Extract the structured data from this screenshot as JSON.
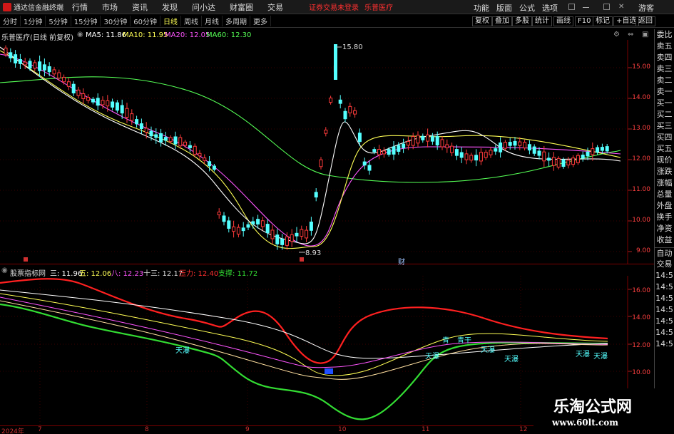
{
  "menubar": {
    "app_title": "通达信金融终端",
    "items": [
      "行情",
      "市场",
      "资讯",
      "发现",
      "问小达",
      "财富圈",
      "交易"
    ],
    "notice": "证券交易未登录",
    "stock_name": "乐普医疗",
    "right_items": [
      "功能",
      "版面",
      "公式",
      "选项"
    ],
    "guest": "游客"
  },
  "periodbar": {
    "periods": [
      "分时",
      "1分钟",
      "5分钟",
      "15分钟",
      "30分钟",
      "60分钟",
      "日线",
      "周线",
      "月线",
      "多周期",
      "更多"
    ],
    "active_period": "日线",
    "tools": [
      "复权",
      "叠加",
      "多股",
      "统计",
      "画线",
      "F10",
      "标记",
      "+自选",
      "返回"
    ]
  },
  "main_chart": {
    "stock_label": "乐普医疗(日线 前复权)",
    "ma5": "MA5: 11.86",
    "ma10": "MA10: 11.95",
    "ma20": "MA20: 12.05",
    "ma60": "MA60: 12.30",
    "high_label": "15.80",
    "low_label": "8.93",
    "marker_wealth": "财",
    "y_ticks": [
      "15.00",
      "14.00",
      "13.00",
      "12.00",
      "11.00",
      "10.00",
      "9.00"
    ]
  },
  "indicator": {
    "name": "股票指标网",
    "three": "三: 11.96",
    "five": "五: 12.06",
    "eight": "八: 12.23",
    "thirteen": "十三: 12.17",
    "pressure": "压力: 12.40",
    "support": "支撑: 11.72",
    "y_ticks": [
      "16.00",
      "14.00",
      "12.00",
      "10.00"
    ],
    "annotations": [
      "天瀑",
      "青",
      "青干",
      "天瀑",
      "天瀑",
      "天瀑",
      "天瀑",
      "天瀑"
    ]
  },
  "right_panel": {
    "items": [
      "委比",
      "卖五",
      "卖四",
      "卖三",
      "卖二",
      "卖一",
      "买一",
      "买二",
      "买三",
      "买四",
      "买五",
      "现价",
      "涨跌",
      "涨幅",
      "总量",
      "外盘",
      "换手",
      "净资",
      "收益",
      "自动",
      "交易",
      "14:5",
      "14:5",
      "14:5",
      "14:5",
      "14:5",
      "14:5",
      "14:5"
    ]
  },
  "time_axis": {
    "labels": [
      "2024年",
      "7",
      "8",
      "9",
      "10",
      "11",
      "12"
    ]
  },
  "watermark": {
    "title": "乐淘公式网",
    "url": "www.60lt.com"
  },
  "colors": {
    "up": "#ff3b3b",
    "down": "#54ffff",
    "ma5": "#ffffff",
    "ma10": "#ffff55",
    "ma20": "#ff55ff",
    "ma60": "#55ff55",
    "pressure": "#ff2020",
    "support": "#33dd33"
  }
}
